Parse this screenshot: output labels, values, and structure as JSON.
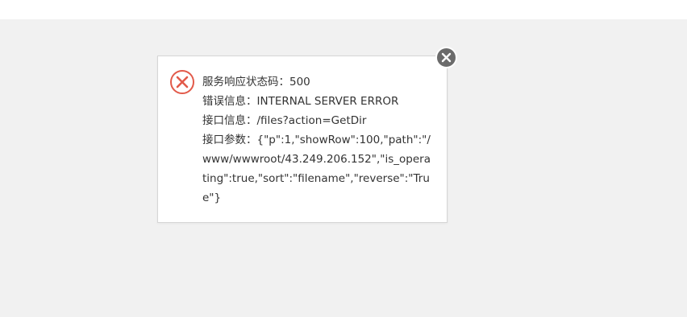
{
  "dialog": {
    "status_line": "服务响应状态码：500",
    "error_line": "错误信息：INTERNAL SERVER ERROR",
    "endpoint_line": "接口信息：/files?action=GetDir",
    "params_line": "接口参数：{\"p\":1,\"showRow\":100,\"path\":\"/www/wwwroot/43.249.206.152\",\"is_operating\":true,\"sort\":\"filename\",\"reverse\":\"True\"}"
  },
  "icons": {
    "status": "error-x-circle-icon",
    "close": "close-icon"
  },
  "colors": {
    "backdrop": "#f1f1f1",
    "error_red": "#e25a4a",
    "close_bg": "#6b6b6b",
    "text": "#333333"
  }
}
